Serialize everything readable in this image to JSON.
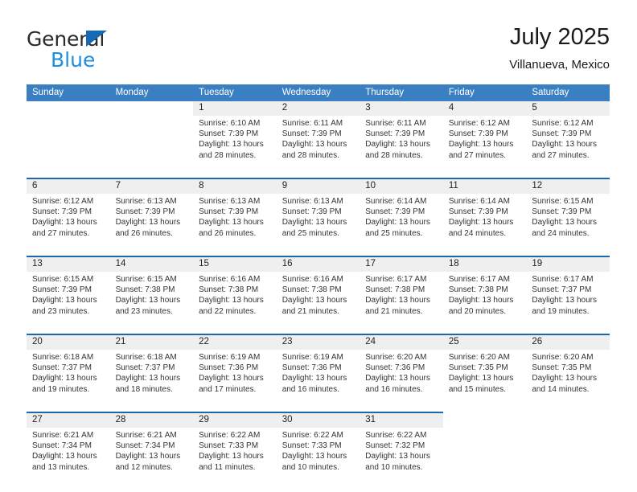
{
  "brand": {
    "name_top": "General",
    "name_bottom": "Blue",
    "triangle_icon": "triangle-logo-icon",
    "color_top": "#2a2a2a",
    "color_bottom": "#1d8fe0",
    "triangle_color": "#1669b2"
  },
  "header": {
    "title": "July 2025",
    "subtitle": "Villanueva, Mexico"
  },
  "colors": {
    "header_blue": "#3a7fc1",
    "row_divider_blue": "#1d67ad",
    "number_band_gray": "#efefef",
    "text": "#333333"
  },
  "weekdays": [
    "Sunday",
    "Monday",
    "Tuesday",
    "Wednesday",
    "Thursday",
    "Friday",
    "Saturday"
  ],
  "labels": {
    "sunrise_prefix": "Sunrise:",
    "sunset_prefix": "Sunset:",
    "daylight_prefix": "Daylight:"
  },
  "weeks": [
    [
      {
        "day": "",
        "lines": []
      },
      {
        "day": "",
        "lines": []
      },
      {
        "day": "1",
        "lines": [
          "Sunrise: 6:10 AM",
          "Sunset: 7:39 PM",
          "Daylight: 13 hours",
          "and 28 minutes."
        ]
      },
      {
        "day": "2",
        "lines": [
          "Sunrise: 6:11 AM",
          "Sunset: 7:39 PM",
          "Daylight: 13 hours",
          "and 28 minutes."
        ]
      },
      {
        "day": "3",
        "lines": [
          "Sunrise: 6:11 AM",
          "Sunset: 7:39 PM",
          "Daylight: 13 hours",
          "and 28 minutes."
        ]
      },
      {
        "day": "4",
        "lines": [
          "Sunrise: 6:12 AM",
          "Sunset: 7:39 PM",
          "Daylight: 13 hours",
          "and 27 minutes."
        ]
      },
      {
        "day": "5",
        "lines": [
          "Sunrise: 6:12 AM",
          "Sunset: 7:39 PM",
          "Daylight: 13 hours",
          "and 27 minutes."
        ]
      }
    ],
    [
      {
        "day": "6",
        "lines": [
          "Sunrise: 6:12 AM",
          "Sunset: 7:39 PM",
          "Daylight: 13 hours",
          "and 27 minutes."
        ]
      },
      {
        "day": "7",
        "lines": [
          "Sunrise: 6:13 AM",
          "Sunset: 7:39 PM",
          "Daylight: 13 hours",
          "and 26 minutes."
        ]
      },
      {
        "day": "8",
        "lines": [
          "Sunrise: 6:13 AM",
          "Sunset: 7:39 PM",
          "Daylight: 13 hours",
          "and 26 minutes."
        ]
      },
      {
        "day": "9",
        "lines": [
          "Sunrise: 6:13 AM",
          "Sunset: 7:39 PM",
          "Daylight: 13 hours",
          "and 25 minutes."
        ]
      },
      {
        "day": "10",
        "lines": [
          "Sunrise: 6:14 AM",
          "Sunset: 7:39 PM",
          "Daylight: 13 hours",
          "and 25 minutes."
        ]
      },
      {
        "day": "11",
        "lines": [
          "Sunrise: 6:14 AM",
          "Sunset: 7:39 PM",
          "Daylight: 13 hours",
          "and 24 minutes."
        ]
      },
      {
        "day": "12",
        "lines": [
          "Sunrise: 6:15 AM",
          "Sunset: 7:39 PM",
          "Daylight: 13 hours",
          "and 24 minutes."
        ]
      }
    ],
    [
      {
        "day": "13",
        "lines": [
          "Sunrise: 6:15 AM",
          "Sunset: 7:39 PM",
          "Daylight: 13 hours",
          "and 23 minutes."
        ]
      },
      {
        "day": "14",
        "lines": [
          "Sunrise: 6:15 AM",
          "Sunset: 7:38 PM",
          "Daylight: 13 hours",
          "and 23 minutes."
        ]
      },
      {
        "day": "15",
        "lines": [
          "Sunrise: 6:16 AM",
          "Sunset: 7:38 PM",
          "Daylight: 13 hours",
          "and 22 minutes."
        ]
      },
      {
        "day": "16",
        "lines": [
          "Sunrise: 6:16 AM",
          "Sunset: 7:38 PM",
          "Daylight: 13 hours",
          "and 21 minutes."
        ]
      },
      {
        "day": "17",
        "lines": [
          "Sunrise: 6:17 AM",
          "Sunset: 7:38 PM",
          "Daylight: 13 hours",
          "and 21 minutes."
        ]
      },
      {
        "day": "18",
        "lines": [
          "Sunrise: 6:17 AM",
          "Sunset: 7:38 PM",
          "Daylight: 13 hours",
          "and 20 minutes."
        ]
      },
      {
        "day": "19",
        "lines": [
          "Sunrise: 6:17 AM",
          "Sunset: 7:37 PM",
          "Daylight: 13 hours",
          "and 19 minutes."
        ]
      }
    ],
    [
      {
        "day": "20",
        "lines": [
          "Sunrise: 6:18 AM",
          "Sunset: 7:37 PM",
          "Daylight: 13 hours",
          "and 19 minutes."
        ]
      },
      {
        "day": "21",
        "lines": [
          "Sunrise: 6:18 AM",
          "Sunset: 7:37 PM",
          "Daylight: 13 hours",
          "and 18 minutes."
        ]
      },
      {
        "day": "22",
        "lines": [
          "Sunrise: 6:19 AM",
          "Sunset: 7:36 PM",
          "Daylight: 13 hours",
          "and 17 minutes."
        ]
      },
      {
        "day": "23",
        "lines": [
          "Sunrise: 6:19 AM",
          "Sunset: 7:36 PM",
          "Daylight: 13 hours",
          "and 16 minutes."
        ]
      },
      {
        "day": "24",
        "lines": [
          "Sunrise: 6:20 AM",
          "Sunset: 7:36 PM",
          "Daylight: 13 hours",
          "and 16 minutes."
        ]
      },
      {
        "day": "25",
        "lines": [
          "Sunrise: 6:20 AM",
          "Sunset: 7:35 PM",
          "Daylight: 13 hours",
          "and 15 minutes."
        ]
      },
      {
        "day": "26",
        "lines": [
          "Sunrise: 6:20 AM",
          "Sunset: 7:35 PM",
          "Daylight: 13 hours",
          "and 14 minutes."
        ]
      }
    ],
    [
      {
        "day": "27",
        "lines": [
          "Sunrise: 6:21 AM",
          "Sunset: 7:34 PM",
          "Daylight: 13 hours",
          "and 13 minutes."
        ]
      },
      {
        "day": "28",
        "lines": [
          "Sunrise: 6:21 AM",
          "Sunset: 7:34 PM",
          "Daylight: 13 hours",
          "and 12 minutes."
        ]
      },
      {
        "day": "29",
        "lines": [
          "Sunrise: 6:22 AM",
          "Sunset: 7:33 PM",
          "Daylight: 13 hours",
          "and 11 minutes."
        ]
      },
      {
        "day": "30",
        "lines": [
          "Sunrise: 6:22 AM",
          "Sunset: 7:33 PM",
          "Daylight: 13 hours",
          "and 10 minutes."
        ]
      },
      {
        "day": "31",
        "lines": [
          "Sunrise: 6:22 AM",
          "Sunset: 7:32 PM",
          "Daylight: 13 hours",
          "and 10 minutes."
        ]
      },
      {
        "day": "",
        "lines": []
      },
      {
        "day": "",
        "lines": []
      }
    ]
  ]
}
